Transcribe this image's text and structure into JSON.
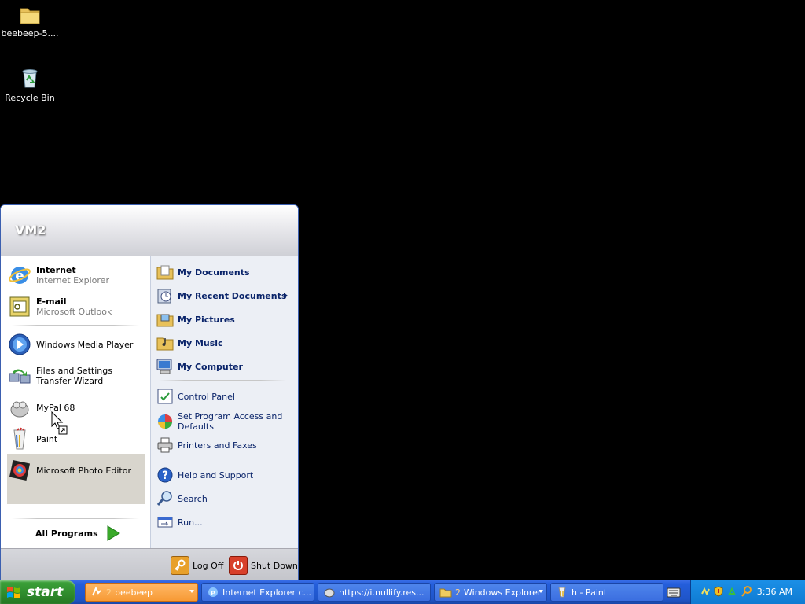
{
  "desktop": {
    "icons": [
      {
        "label": "beebeep-5...."
      },
      {
        "label": "Recycle Bin"
      }
    ]
  },
  "start_menu": {
    "user_name": "VM2",
    "pinned": [
      {
        "title": "Internet",
        "subtitle": "Internet Explorer"
      },
      {
        "title": "E-mail",
        "subtitle": "Microsoft Outlook"
      }
    ],
    "recent": [
      {
        "label": "Windows Media Player"
      },
      {
        "label": "Files and Settings Transfer Wizard"
      },
      {
        "label": "MyPal 68"
      },
      {
        "label": "Paint"
      },
      {
        "label": "Microsoft Photo Editor"
      }
    ],
    "all_programs": "All Programs",
    "places": [
      {
        "label": "My Documents"
      },
      {
        "label": "My Recent Documents"
      },
      {
        "label": "My Pictures"
      },
      {
        "label": "My Music"
      },
      {
        "label": "My Computer"
      }
    ],
    "system": [
      {
        "label": "Control Panel"
      },
      {
        "label": "Set Program Access and Defaults"
      },
      {
        "label": "Printers and Faxes"
      }
    ],
    "help": [
      {
        "label": "Help and Support"
      },
      {
        "label": "Search"
      },
      {
        "label": "Run..."
      }
    ],
    "footer": {
      "log_off": "Log Off",
      "shut_down": "Shut Down"
    }
  },
  "taskbar": {
    "start_label": "start",
    "buttons": [
      {
        "count": "2",
        "label": "beebeep"
      },
      {
        "label": "Internet Explorer c..."
      },
      {
        "label": "https://i.nullify.res..."
      },
      {
        "count": "2",
        "label": "Windows Explorer"
      },
      {
        "label": "h - Paint"
      }
    ],
    "clock": "3:36 AM"
  }
}
